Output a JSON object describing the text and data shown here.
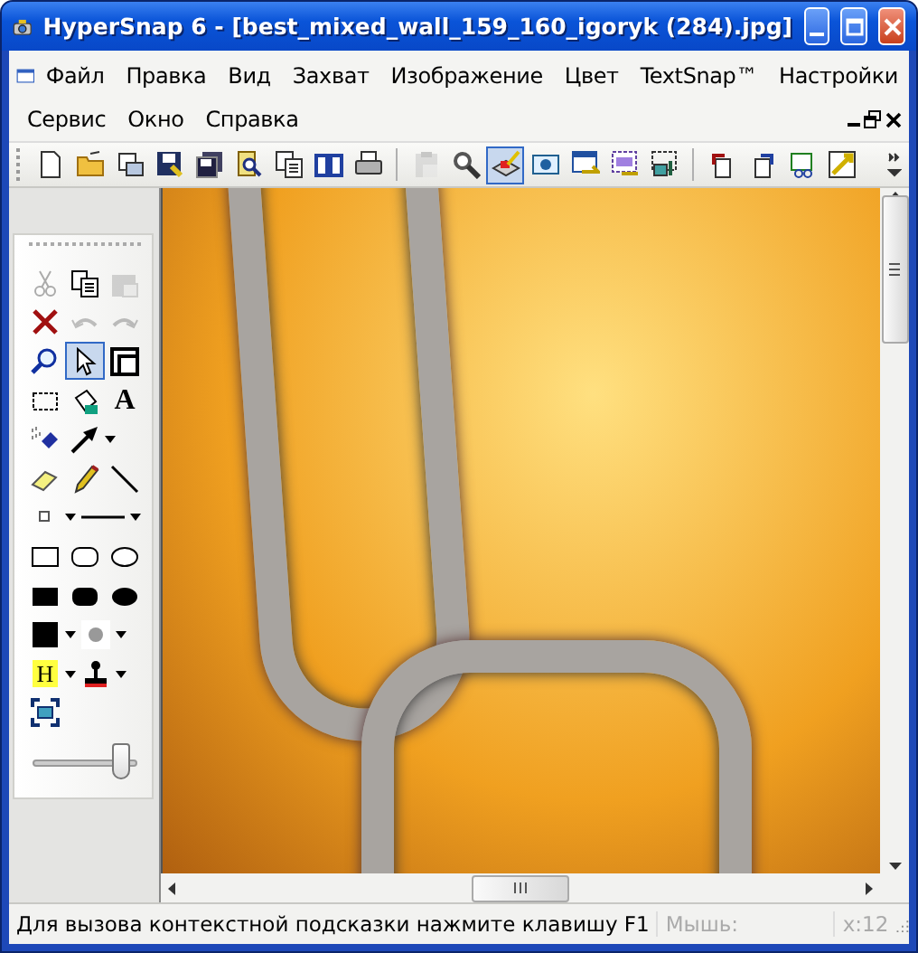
{
  "window": {
    "title": "HyperSnap 6 - [best_mixed_wall_159_160_igoryk (284).jpg]"
  },
  "menu": {
    "rows": [
      [
        "Файл",
        "Правка",
        "Вид",
        "Захват",
        "Изображение",
        "Цвет",
        "TextSnap™",
        "Настройки"
      ],
      [
        "Сервис",
        "Окно",
        "Справка"
      ]
    ]
  },
  "toolbar": {
    "buttons": [
      {
        "selected": false,
        "disabled": false
      },
      {
        "selected": false,
        "disabled": false
      },
      {
        "selected": false,
        "disabled": false
      },
      {
        "selected": false,
        "disabled": false
      },
      {
        "selected": false,
        "disabled": false
      },
      {
        "selected": false,
        "disabled": false
      },
      {
        "selected": false,
        "disabled": false
      },
      {
        "selected": false,
        "disabled": false
      },
      {
        "selected": false,
        "disabled": false
      },
      {
        "selected": false,
        "disabled": true
      },
      {
        "selected": false,
        "disabled": false
      },
      {
        "selected": true,
        "disabled": false
      },
      {
        "selected": false,
        "disabled": false
      },
      {
        "selected": false,
        "disabled": false
      },
      {
        "selected": false,
        "disabled": false
      },
      {
        "selected": false,
        "disabled": false
      },
      {
        "selected": false,
        "disabled": false
      },
      {
        "selected": false,
        "disabled": false
      },
      {
        "selected": false,
        "disabled": false
      },
      {
        "selected": false,
        "disabled": false
      }
    ]
  },
  "palette": {
    "tools": [
      {
        "selected": false,
        "disabled": true
      },
      {
        "selected": false,
        "disabled": false
      },
      {
        "selected": false,
        "disabled": true
      },
      {
        "selected": false,
        "disabled": false
      },
      {
        "selected": false,
        "disabled": true
      },
      {
        "selected": false,
        "disabled": true
      },
      {
        "selected": false,
        "disabled": false
      },
      {
        "selected": true,
        "disabled": false
      },
      {
        "selected": false,
        "disabled": false
      },
      {
        "selected": false,
        "disabled": false
      },
      {
        "selected": false,
        "disabled": false
      },
      {
        "selected": false,
        "disabled": false,
        "label": "A"
      },
      {
        "selected": false,
        "disabled": false
      },
      {
        "selected": false,
        "disabled": false
      },
      {
        "selected": false,
        "disabled": false
      },
      {
        "selected": false,
        "disabled": false
      },
      {
        "selected": false,
        "disabled": false
      },
      {
        "selected": false,
        "disabled": false
      },
      {
        "selected": false,
        "disabled": false
      },
      {
        "selected": false,
        "disabled": false
      },
      {
        "selected": false,
        "disabled": false
      },
      {
        "selected": false,
        "disabled": false
      },
      {
        "selected": false,
        "disabled": false
      },
      {
        "selected": false,
        "disabled": false
      },
      {
        "selected": false,
        "disabled": false
      },
      {
        "selected": false,
        "disabled": false
      },
      {
        "selected": false,
        "disabled": false
      },
      {
        "selected": false,
        "disabled": false,
        "label": "H"
      },
      {
        "selected": false,
        "disabled": false
      },
      {
        "selected": false,
        "disabled": false
      }
    ],
    "slider": {
      "level": 0.85
    }
  },
  "status_bar": {
    "hint": "Для вызова контекстной подсказки нажмите клавишу F1",
    "mouse_label": "Мышь:",
    "coords": "x:12"
  }
}
